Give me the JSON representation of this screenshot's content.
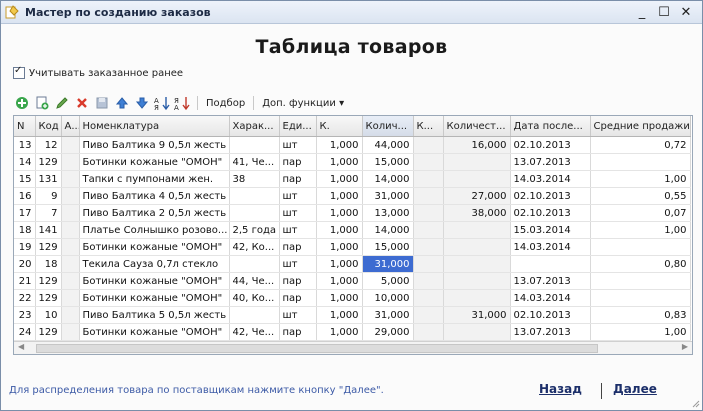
{
  "window": {
    "title": "Мастер по созданию заказов"
  },
  "heading": "Таблица товаров",
  "checkbox": {
    "label": "Учитывать заказанное ранее",
    "checked": true
  },
  "toolbar": {
    "select_label": "Подбор",
    "more_label": "Доп. функции"
  },
  "columns": [
    "N",
    "Код",
    "А...",
    "Номенклатура",
    "Харак...",
    "Еди...",
    "К.",
    "Колич...",
    "К...",
    "Количест...",
    "Дата после...",
    "Средние продажи"
  ],
  "rows": [
    [
      "13",
      "12",
      "",
      "Пиво Балтика 9 0,5л жесть",
      "",
      "шт",
      "1,000",
      "44,000",
      "",
      "16,000",
      "02.10.2013",
      "0,72"
    ],
    [
      "14",
      "129",
      "",
      "Ботинки кожаные \"ОМОН\"",
      "41, Че...",
      "пар",
      "1,000",
      "15,000",
      "",
      "",
      "13.07.2013",
      ""
    ],
    [
      "15",
      "131",
      "",
      "Тапки с пумпонами жен.",
      "38",
      "пар",
      "1,000",
      "14,000",
      "",
      "",
      "14.03.2014",
      "1,00"
    ],
    [
      "16",
      "9",
      "",
      "Пиво Балтика 4 0,5л жесть",
      "",
      "шт",
      "1,000",
      "31,000",
      "",
      "27,000",
      "02.10.2013",
      "0,55"
    ],
    [
      "17",
      "7",
      "",
      "Пиво Балтика 2 0,5л жесть",
      "",
      "шт",
      "1,000",
      "13,000",
      "",
      "38,000",
      "02.10.2013",
      "0,07"
    ],
    [
      "18",
      "141",
      "",
      "Платье Солнышко розово...",
      "2,5 года",
      "шт",
      "1,000",
      "14,000",
      "",
      "",
      "15.03.2014",
      "1,00"
    ],
    [
      "19",
      "129",
      "",
      "Ботинки кожаные \"ОМОН\"",
      "42, Ко...",
      "пар",
      "1,000",
      "15,000",
      "",
      "",
      "14.03.2014",
      ""
    ],
    [
      "20",
      "18",
      "",
      "Текила Сауза 0,7л стекло",
      "",
      "шт",
      "1,000",
      "31,000",
      "",
      "",
      "",
      "0,80"
    ],
    [
      "21",
      "129",
      "",
      "Ботинки кожаные \"ОМОН\"",
      "44, Че...",
      "пар",
      "1,000",
      "5,000",
      "",
      "",
      "13.07.2013",
      ""
    ],
    [
      "22",
      "129",
      "",
      "Ботинки кожаные \"ОМОН\"",
      "40, Ко...",
      "пар",
      "1,000",
      "10,000",
      "",
      "",
      "14.03.2014",
      ""
    ],
    [
      "23",
      "10",
      "",
      "Пиво Балтика 5 0,5л жесть",
      "",
      "шт",
      "1,000",
      "31,000",
      "",
      "31,000",
      "02.10.2013",
      "0,83"
    ],
    [
      "24",
      "129",
      "",
      "Ботинки кожаные \"ОМОН\"",
      "42, Че...",
      "пар",
      "1,000",
      "29,000",
      "",
      "",
      "13.07.2013",
      "1,00"
    ]
  ],
  "selected_cell": {
    "row": 7,
    "col": 7
  },
  "footer": {
    "hint": "Для распределения товара по поставщикам нажмите кнопку \"Далее\".",
    "back_label": "Назад",
    "next_label": "Далее"
  }
}
